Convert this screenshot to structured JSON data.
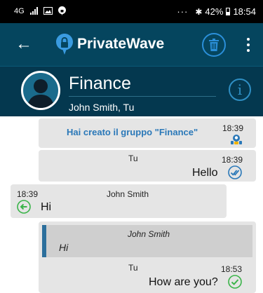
{
  "status_bar": {
    "network": "4G",
    "battery": "42%",
    "time": "18:54",
    "ellipsis": "···",
    "bluetooth_glyph": "✱"
  },
  "app_bar": {
    "back_glyph": "←",
    "app_name": "PrivateWave",
    "logo_icon": "lock-speech-bubble",
    "delete_icon": "trash-icon",
    "menu_icon": "overflow-menu-icon"
  },
  "group_header": {
    "name": "Finance",
    "members": "John Smith, Tu",
    "info_glyph": "i"
  },
  "messages": [
    {
      "type": "system",
      "text": "Hai creato il gruppo \"Finance\"",
      "time": "18:39",
      "status_icon": "group-members-icon"
    },
    {
      "type": "outgoing",
      "sender": "Tu",
      "time": "18:39",
      "text": "Hello",
      "status_icon": "delivered-double-check-icon"
    },
    {
      "type": "incoming",
      "sender": "John Smith",
      "time": "18:39",
      "text": "Hi",
      "status_icon": "reply-arrow-icon"
    },
    {
      "type": "outgoing",
      "sender": "Tu",
      "time": "18:53",
      "text": "How are you?",
      "status_icon": "sent-check-icon",
      "quote": {
        "sender": "John Smith",
        "text": "Hi"
      }
    }
  ],
  "colors": {
    "app_bar": "#05455e",
    "group_bar": "#04384f",
    "accent_blue": "#2a78b8",
    "check_green": "#3bb44a",
    "bubble_gray": "#e5e5e5"
  }
}
